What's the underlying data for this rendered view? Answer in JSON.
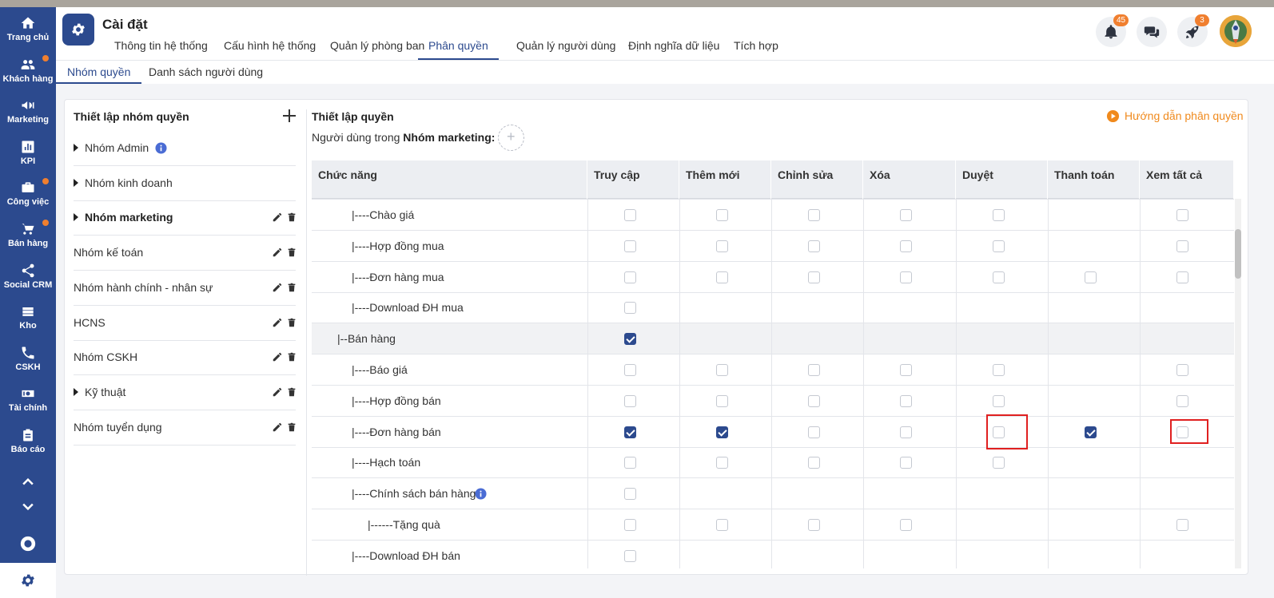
{
  "sidebar": {
    "items": [
      {
        "label": "Trang chủ",
        "icon": "home-icon",
        "dot": false
      },
      {
        "label": "Khách hàng",
        "icon": "users-icon",
        "dot": true
      },
      {
        "label": "Marketing",
        "icon": "megaphone-icon",
        "dot": false
      },
      {
        "label": "KPI",
        "icon": "chart-icon",
        "dot": false
      },
      {
        "label": "Công việc",
        "icon": "briefcase-icon",
        "dot": true
      },
      {
        "label": "Bán hàng",
        "icon": "cart-icon",
        "dot": true
      },
      {
        "label": "Social CRM",
        "icon": "share-icon",
        "dot": false
      },
      {
        "label": "Kho",
        "icon": "warehouse-icon",
        "dot": false
      },
      {
        "label": "CSKH",
        "icon": "phone-icon",
        "dot": false
      },
      {
        "label": "Tài chính",
        "icon": "money-icon",
        "dot": false
      },
      {
        "label": "Báo cáo",
        "icon": "clipboard-icon",
        "dot": false
      }
    ]
  },
  "header": {
    "title": "Cài đặt",
    "tabs": [
      {
        "label": "Thông tin hệ thống",
        "active": false
      },
      {
        "label": "Cấu hình hệ thống",
        "active": false
      },
      {
        "label": "Quản lý phòng ban",
        "active": false
      },
      {
        "label": "Phân quyền",
        "active": true
      },
      {
        "label": "Quản lý người dùng",
        "active": false
      },
      {
        "label": "Định nghĩa dữ liệu",
        "active": false
      },
      {
        "label": "Tích hợp",
        "active": false
      }
    ],
    "notifications_count": "45",
    "rocket_count": "3"
  },
  "subtabs": [
    {
      "label": "Nhóm quyền",
      "active": true
    },
    {
      "label": "Danh sách người dùng",
      "active": false
    }
  ],
  "left_panel": {
    "title": "Thiết lập nhóm quyền",
    "groups": [
      {
        "name": "Nhóm Admin",
        "caret": true,
        "info": true,
        "actions": false,
        "bold": false
      },
      {
        "name": "Nhóm kinh doanh",
        "caret": true,
        "info": false,
        "actions": false,
        "bold": false
      },
      {
        "name": "Nhóm marketing",
        "caret": true,
        "info": false,
        "actions": true,
        "bold": true
      },
      {
        "name": "Nhóm kế toán",
        "caret": false,
        "info": false,
        "actions": true,
        "bold": false
      },
      {
        "name": "Nhóm hành chính - nhân sự",
        "caret": false,
        "info": false,
        "actions": true,
        "bold": false
      },
      {
        "name": "HCNS",
        "caret": false,
        "info": false,
        "actions": true,
        "bold": false
      },
      {
        "name": "Nhóm CSKH",
        "caret": false,
        "info": false,
        "actions": true,
        "bold": false
      },
      {
        "name": "Kỹ thuật",
        "caret": true,
        "info": false,
        "actions": true,
        "bold": false
      },
      {
        "name": "Nhóm tuyển dụng",
        "caret": false,
        "info": false,
        "actions": true,
        "bold": false
      }
    ]
  },
  "right_panel": {
    "title": "Thiết lập quyền",
    "users_prefix": "Người dùng trong",
    "group_name": "Nhóm marketing:",
    "guide_label": "Hướng dẫn phân quyền",
    "columns": [
      "Chức năng",
      "Truy cập",
      "Thêm mới",
      "Chỉnh sửa",
      "Xóa",
      "Duyệt",
      "Thanh toán",
      "Xem tất cả"
    ],
    "rows": [
      {
        "name": "|----Chào giá",
        "level": 2,
        "parent": false,
        "info": false,
        "cells": [
          0,
          0,
          0,
          0,
          0,
          null,
          0
        ]
      },
      {
        "name": "|----Hợp đồng mua",
        "level": 2,
        "parent": false,
        "info": false,
        "cells": [
          0,
          0,
          0,
          0,
          0,
          null,
          0
        ]
      },
      {
        "name": "|----Đơn hàng mua",
        "level": 2,
        "parent": false,
        "info": false,
        "cells": [
          0,
          0,
          0,
          0,
          0,
          0,
          0
        ]
      },
      {
        "name": "|----Download ĐH mua",
        "level": 2,
        "parent": false,
        "info": false,
        "cells": [
          0,
          null,
          null,
          null,
          null,
          null,
          null
        ]
      },
      {
        "name": "|--Bán hàng",
        "level": 1,
        "parent": true,
        "info": false,
        "cells": [
          1,
          null,
          null,
          null,
          null,
          null,
          null
        ]
      },
      {
        "name": "|----Báo giá",
        "level": 2,
        "parent": false,
        "info": false,
        "cells": [
          0,
          0,
          0,
          0,
          0,
          null,
          0
        ]
      },
      {
        "name": "|----Hợp đồng bán",
        "level": 2,
        "parent": false,
        "info": false,
        "cells": [
          0,
          0,
          0,
          0,
          0,
          null,
          0
        ]
      },
      {
        "name": "|----Đơn hàng bán",
        "level": 2,
        "parent": false,
        "info": false,
        "cells": [
          1,
          1,
          0,
          0,
          0,
          1,
          0
        ],
        "highlight": [
          4,
          6
        ]
      },
      {
        "name": "|----Hạch toán",
        "level": 2,
        "parent": false,
        "info": false,
        "cells": [
          0,
          0,
          0,
          0,
          0,
          null,
          null
        ]
      },
      {
        "name": "|----Chính sách bán hàng",
        "level": 2,
        "parent": false,
        "info": true,
        "cells": [
          0,
          null,
          null,
          null,
          null,
          null,
          null
        ]
      },
      {
        "name": "|------Tặng quà",
        "level": 3,
        "parent": false,
        "info": false,
        "cells": [
          0,
          0,
          0,
          0,
          null,
          null,
          0
        ]
      },
      {
        "name": "|----Download ĐH bán",
        "level": 2,
        "parent": false,
        "info": false,
        "cells": [
          0,
          null,
          null,
          null,
          null,
          null,
          null
        ]
      }
    ]
  },
  "colors": {
    "primary": "#2c4a8e",
    "accent": "#f07f2f",
    "guide": "#f08a1d",
    "highlight": "#e02020"
  }
}
